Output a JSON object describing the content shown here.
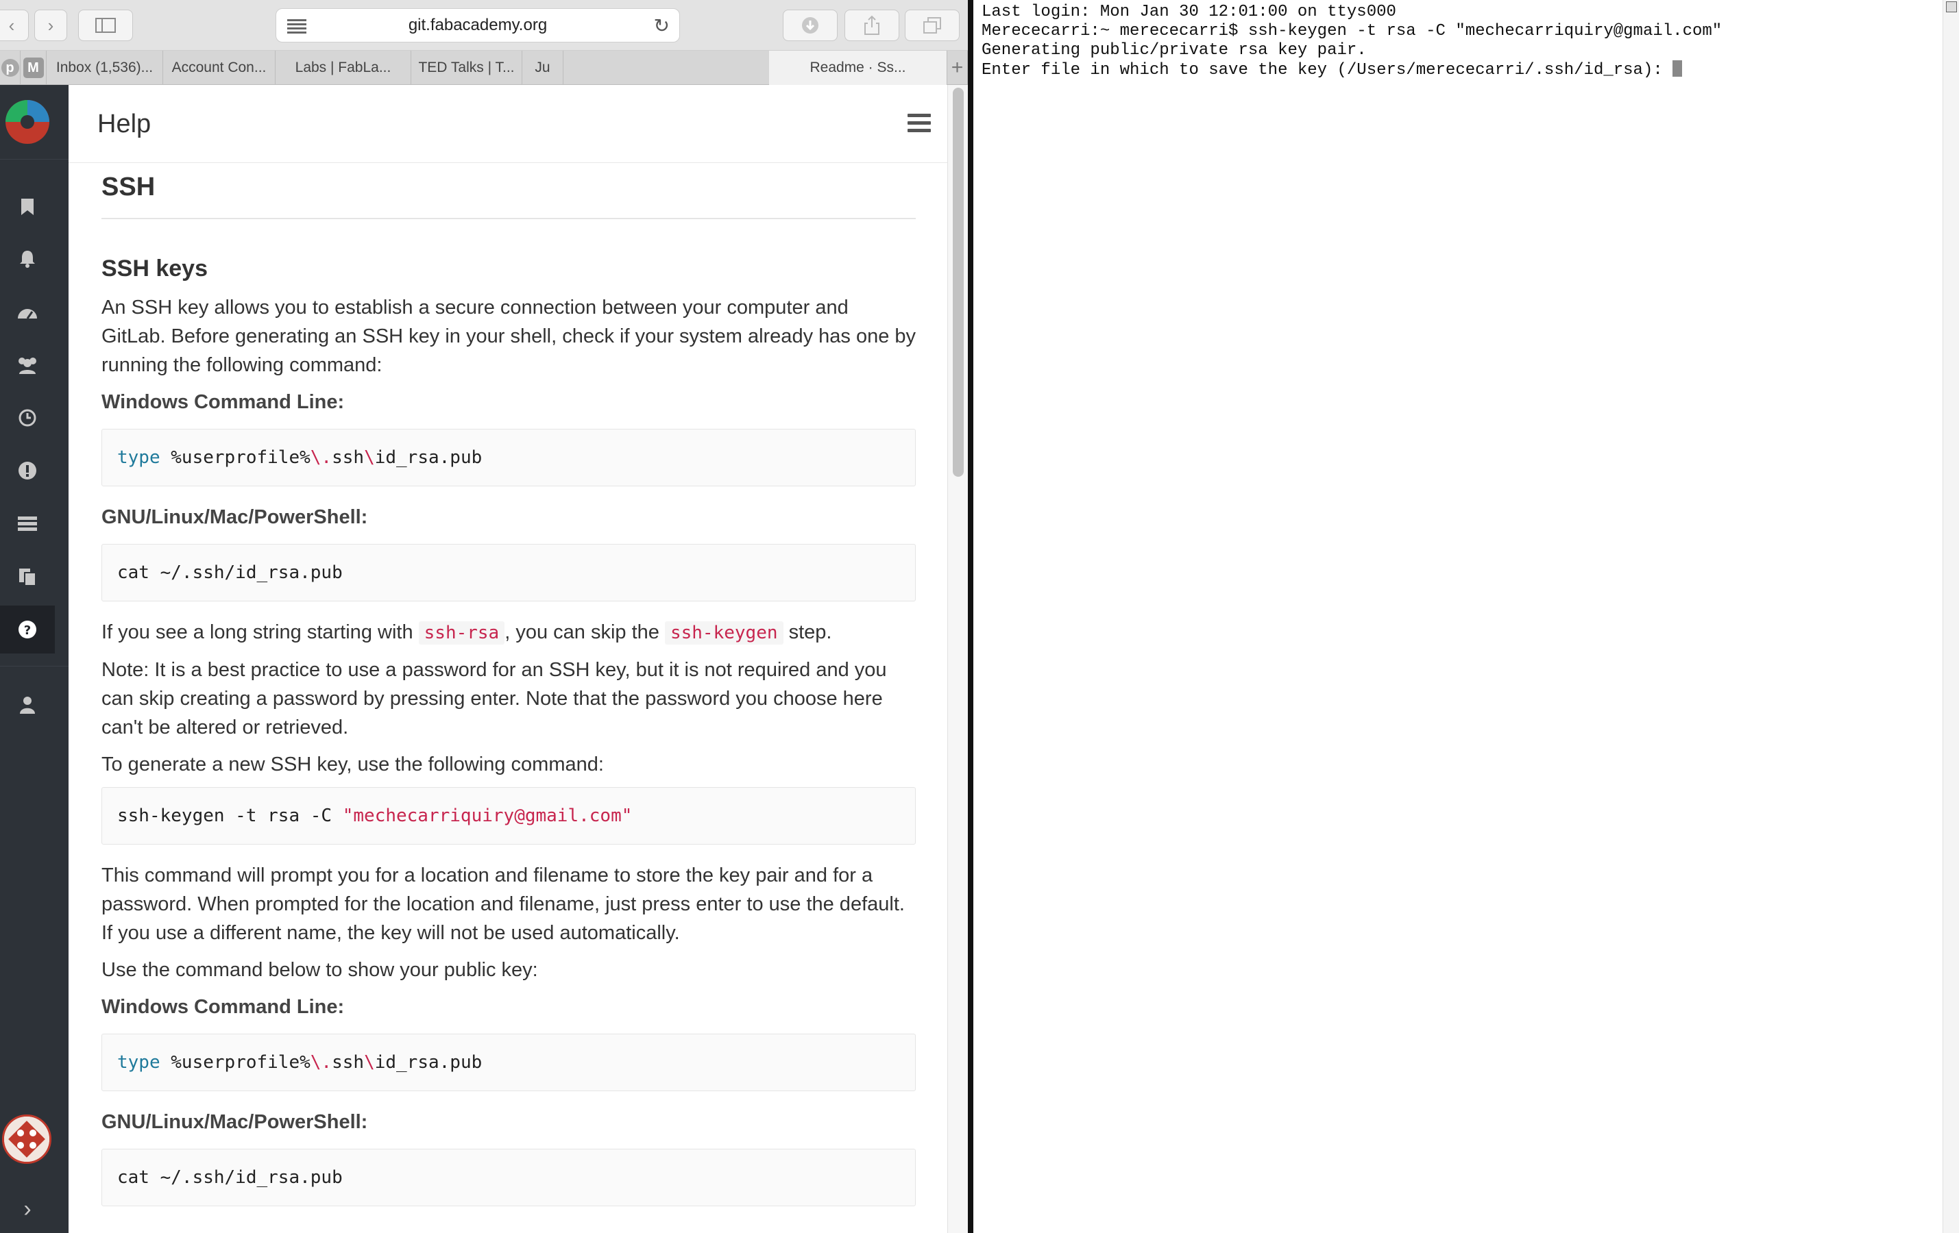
{
  "browser": {
    "url": "git.fabacademy.org",
    "tabs": [
      {
        "label": "Inbox (1,536)..."
      },
      {
        "label": "Account Con..."
      },
      {
        "label": "Labs | FabLa..."
      },
      {
        "label": "TED Talks | T..."
      },
      {
        "label": "Ju"
      },
      {
        "label": "Readme · Ss..."
      }
    ],
    "favicon_m": "M"
  },
  "page": {
    "header_title": "Help",
    "h1": "SSH",
    "h2": "SSH keys",
    "intro": "An SSH key allows you to establish a secure connection between your computer and GitLab. Before generating an SSH key in your shell, check if your system already has one by running the following command:",
    "windows_label": "Windows Command Line:",
    "gnu_label": "GNU/Linux/Mac/PowerShell:",
    "cmd_type_kw": "type",
    "cmd_type_a": " %userprofile%",
    "cmd_type_b": "\\.",
    "cmd_type_c": "ssh",
    "cmd_type_d": "\\",
    "cmd_type_e": "id_rsa.pub",
    "cmd_cat": "cat ~/.ssh/id_rsa.pub",
    "skip_a": "If you see a long string starting with ",
    "skip_code1": "ssh-rsa",
    "skip_b": ", you can skip the ",
    "skip_code2": "ssh-keygen",
    "skip_c": " step.",
    "note": "Note: It is a best practice to use a password for an SSH key, but it is not required and you can skip creating a password by pressing enter. Note that the password you choose here can't be altered or retrieved.",
    "generate_text": "To generate a new SSH key, use the following command:",
    "keygen_cmd": "ssh-keygen -t rsa -C ",
    "keygen_email": "\"mechecarriquiry@gmail.com\"",
    "prompt_text": "This command will prompt you for a location and filename to store the key pair and for a password. When prompted for the location and filename, just press enter to use the default. If you use a different name, the key will not be used automatically.",
    "show_key_text": "Use the command below to show your public key:"
  },
  "terminal": {
    "line1": "Last login: Mon Jan 30 12:01:00 on ttys000",
    "line2": "Merececarri:~ merececarri$ ssh-keygen -t rsa -C \"mechecarriquiry@gmail.com\"",
    "line3": "Generating public/private rsa key pair.",
    "line4": "Enter file in which to save the key (/Users/merececarri/.ssh/id_rsa): "
  }
}
